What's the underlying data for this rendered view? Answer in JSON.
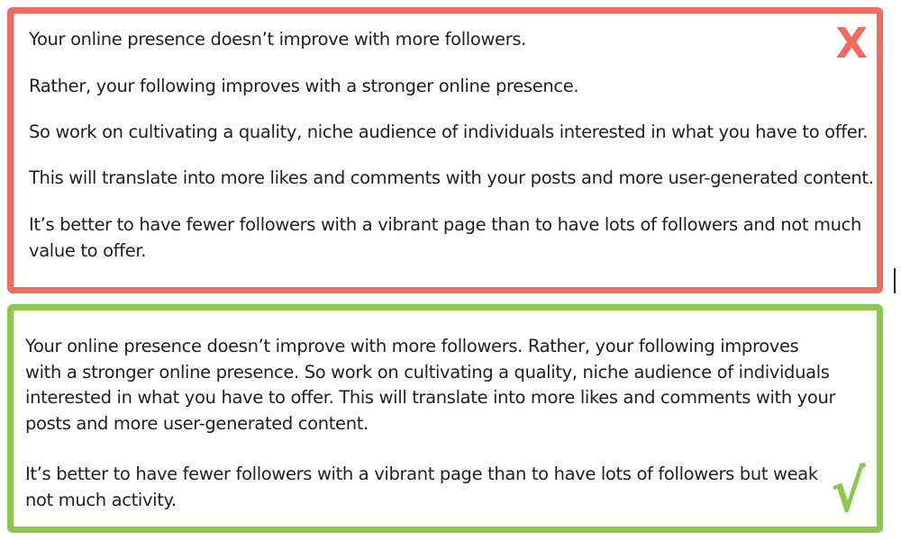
{
  "bad_example": {
    "border_color": "#f36b5f",
    "mark_symbol": "X",
    "mark_color": "#f36b5f",
    "paragraphs": [
      [
        "Your online presence doesn’t improve with more followers."
      ],
      [
        "Rather, your following improves with a stronger online presence."
      ],
      [
        "So work on cultivating a quality, niche audience of individuals interested in what you have to offer."
      ],
      [
        "This will translate into more likes and comments with your posts and more user-generated content."
      ],
      [
        "It’s better to have fewer followers with a vibrant page than to have lots of followers and not much",
        "value to offer."
      ]
    ]
  },
  "good_example": {
    "border_color": "#8cc84b",
    "mark_symbol": "√",
    "mark_color": "#8cc84b",
    "paragraphs": [
      [
        "Your online presence doesn’t improve with more followers. Rather, your following improves",
        "with a stronger online presence. So work on cultivating a quality, niche audience of individuals",
        "interested in what you have to offer. This will translate into more likes and comments with your",
        "posts and more user-generated content."
      ],
      [
        "It’s better to have fewer followers with a vibrant page than to have lots of followers but weak",
        "not much activity."
      ]
    ]
  }
}
